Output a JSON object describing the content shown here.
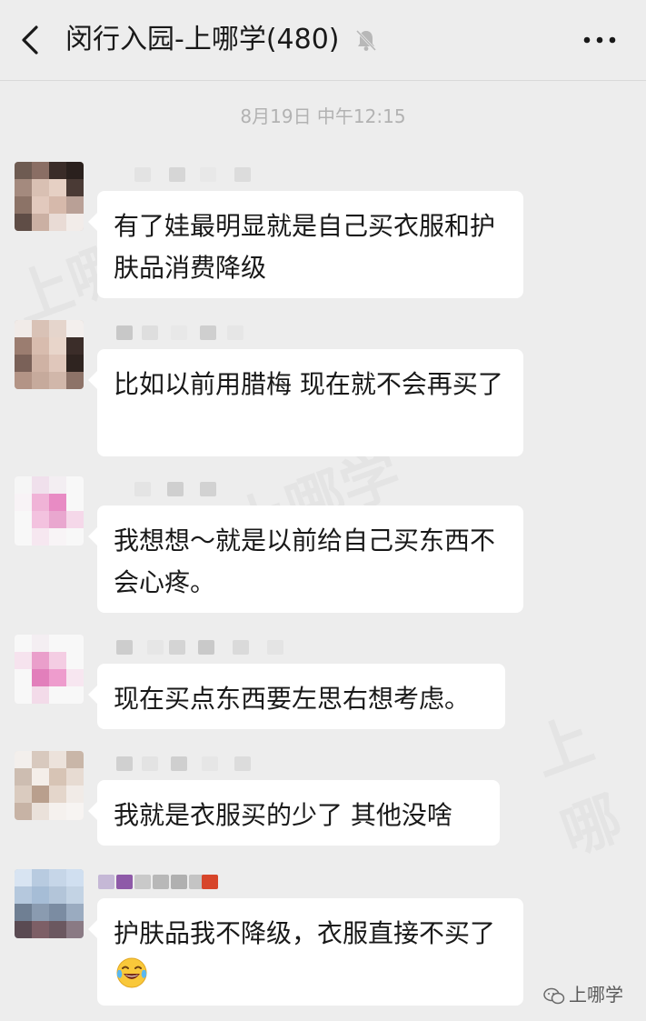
{
  "header": {
    "title": "闵行入园-上哪学(480)",
    "back_icon": "chevron-left-icon",
    "mute_icon": "bell-muted-icon",
    "more_icon": "ellipsis-icon"
  },
  "timestamp": "8月19日 中午12:15",
  "messages": [
    {
      "text": "有了娃最明显就是自己买衣服和护肤品消费降级"
    },
    {
      "text": "比如以前用腊梅 现在就不会再买了"
    },
    {
      "text": "我想想～就是以前给自己买东西不会心疼。"
    },
    {
      "text": "现在买点东西要左思右想考虑。"
    },
    {
      "text": "我就是衣服买的少了 其他没啥"
    },
    {
      "text": "护肤品我不降级，衣服直接不买了",
      "emoji": "laughing-tears-emoji"
    }
  ],
  "footer": {
    "brand": "上哪学"
  },
  "colors": {
    "background": "#ededed",
    "bubble": "#ffffff",
    "text": "#191919",
    "timestamp": "#b2b2b2"
  }
}
